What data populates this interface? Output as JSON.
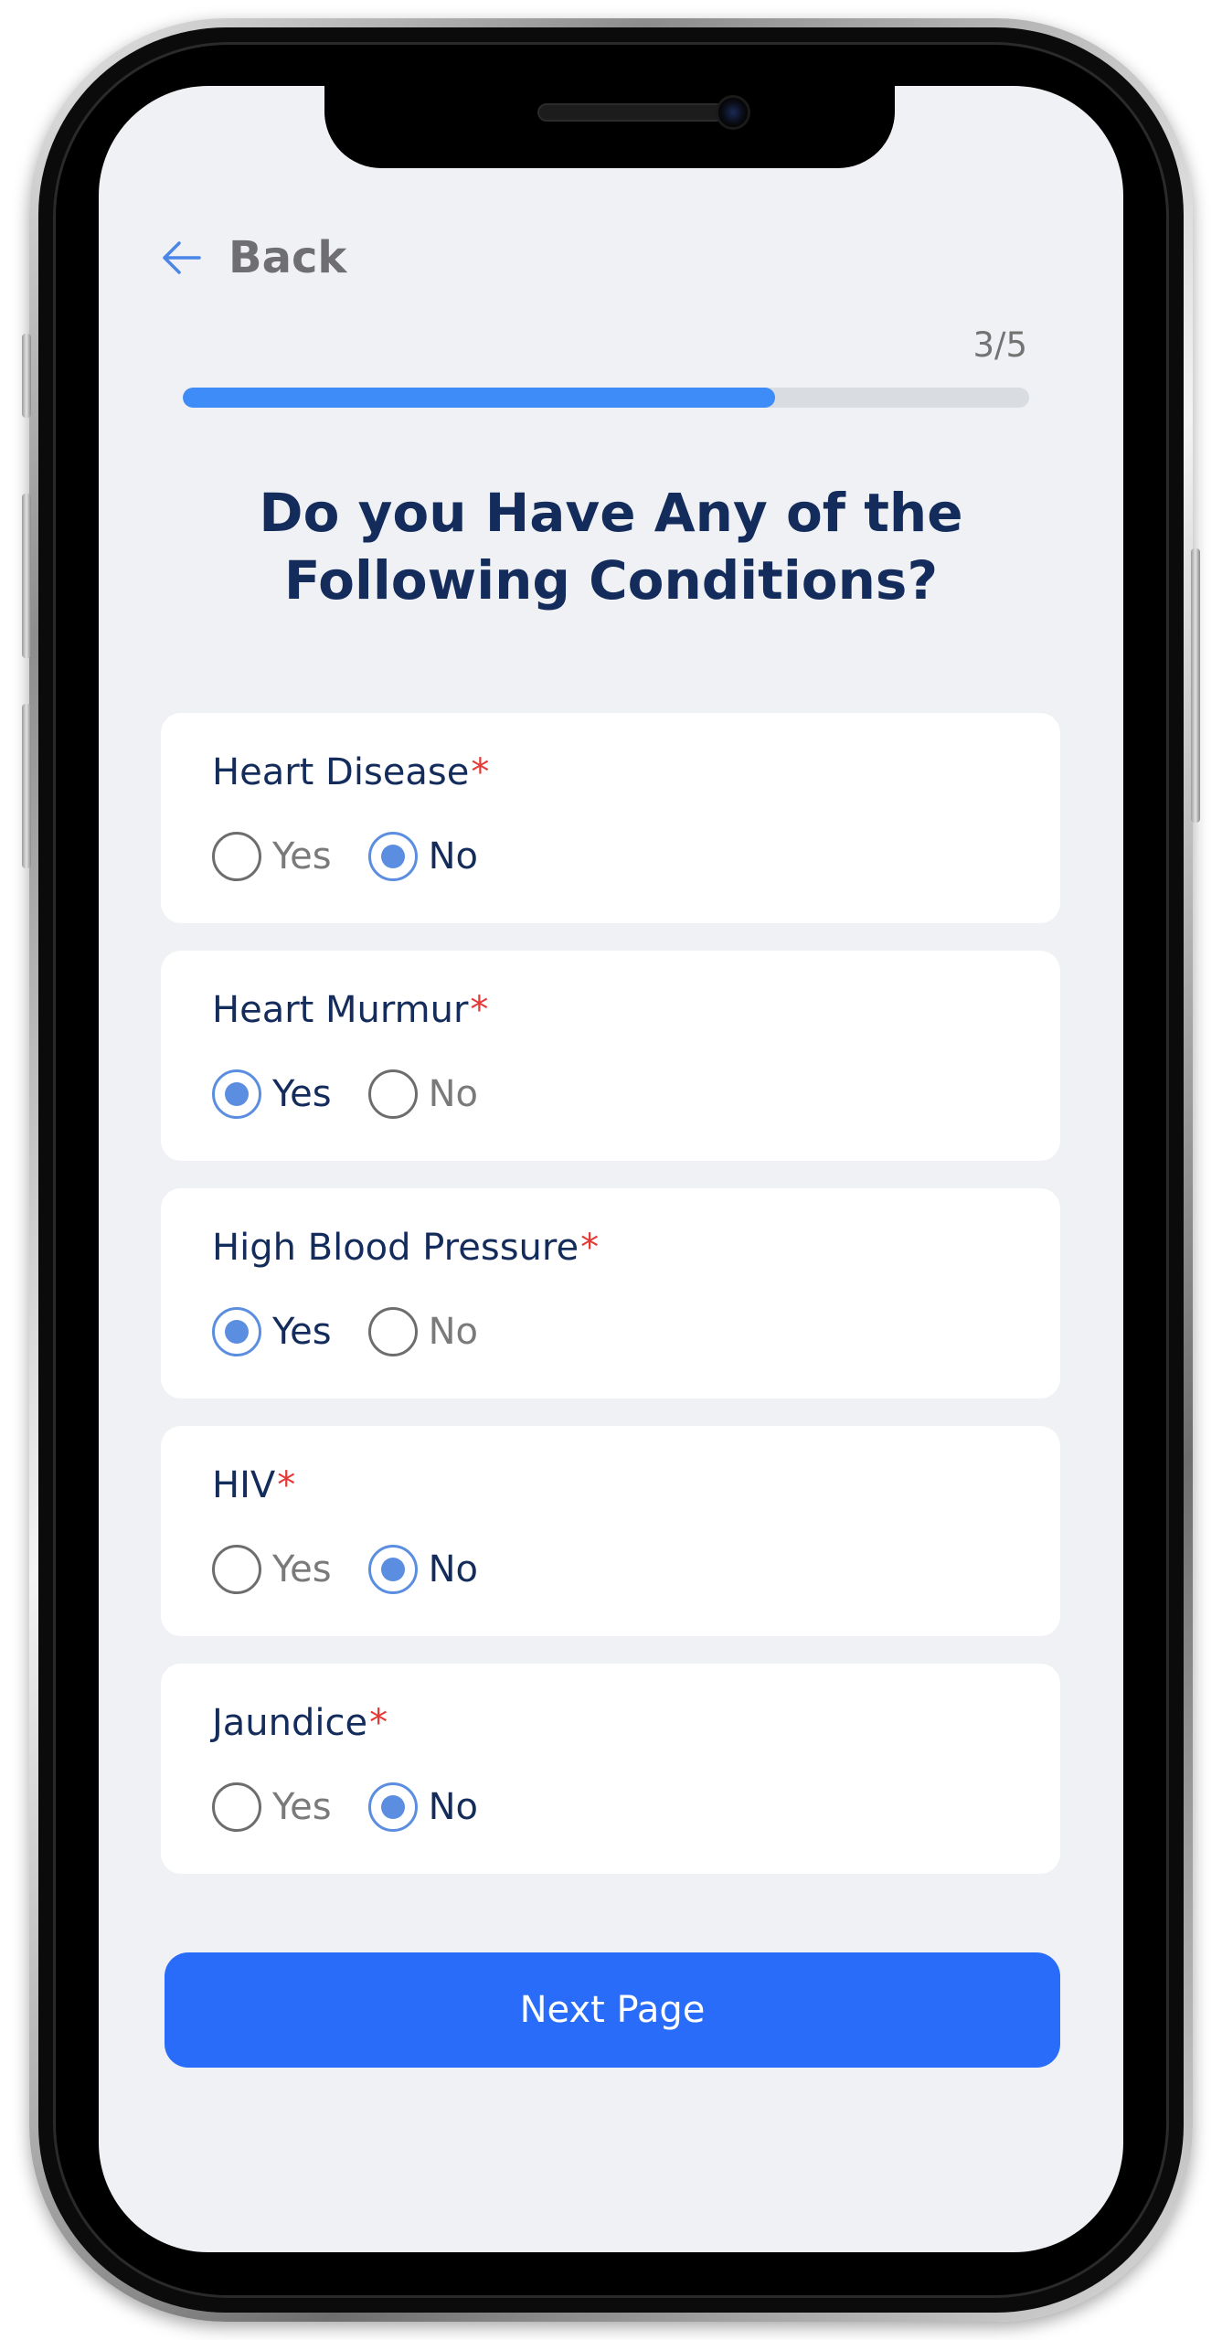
{
  "header": {
    "back_label": "Back",
    "back_icon": "arrow-left-icon"
  },
  "progress": {
    "label": "3/5",
    "current": 3,
    "total": 5,
    "fill_fraction": 0.7,
    "fill_color": "#3d8cf8"
  },
  "title": {
    "line1": "Do you Have Any of the",
    "line2": "Following Conditions?"
  },
  "questions": [
    {
      "label": "Heart Disease",
      "required_mark": "*",
      "yes_label": "Yes",
      "no_label": "No",
      "selected": "No"
    },
    {
      "label": "Heart Murmur",
      "required_mark": "*",
      "yes_label": "Yes",
      "no_label": "No",
      "selected": "Yes"
    },
    {
      "label": "High Blood Pressure",
      "required_mark": "*",
      "yes_label": "Yes",
      "no_label": "No",
      "selected": "Yes"
    },
    {
      "label": "HIV",
      "required_mark": "*",
      "yes_label": "Yes",
      "no_label": "No",
      "selected": "No"
    },
    {
      "label": "Jaundice",
      "required_mark": "*",
      "yes_label": "Yes",
      "no_label": "No",
      "selected": "No"
    }
  ],
  "footer": {
    "next_label": "Next Page"
  },
  "colors": {
    "accent": "#2a6cfa",
    "radio_selected": "#5b8ee0",
    "title": "#142c5c",
    "required": "#e53935",
    "screen_bg": "#f0f1f4"
  }
}
